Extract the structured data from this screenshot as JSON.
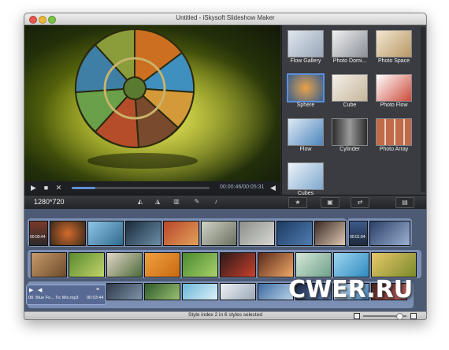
{
  "window": {
    "title": "Untitled - iSkysoft Slideshow Maker"
  },
  "player": {
    "time": "00:00:46/00:05:31",
    "progress": 0.17
  },
  "styles": [
    {
      "label": "Flow Gallery",
      "selected": false
    },
    {
      "label": "Photo Domi...",
      "selected": false
    },
    {
      "label": "Photo Space",
      "selected": false
    },
    {
      "label": "Sphere",
      "selected": true
    },
    {
      "label": "Cube",
      "selected": false
    },
    {
      "label": "Photo Flow",
      "selected": false
    },
    {
      "label": "Flow",
      "selected": false
    },
    {
      "label": "Cylinder",
      "selected": false
    },
    {
      "label": "Photo Array",
      "selected": false
    },
    {
      "label": "Cubes",
      "selected": false
    }
  ],
  "toolbar": {
    "resolution": "1280*720"
  },
  "storyboard": {
    "row1_duration_start": "00:00:44",
    "row1_duration_end": "00:01:04",
    "music": {
      "filename": "08. Blue Fo... Tic Mix.mp3",
      "duration": "00:03:44"
    }
  },
  "status": {
    "text": "Style index 2 in 6 styles selected"
  },
  "watermark": "CWER.RU",
  "colors": {
    "accent": "#5d8fd9",
    "storyboard": "#4c5a73",
    "preview_glow": "#b9c31e"
  }
}
